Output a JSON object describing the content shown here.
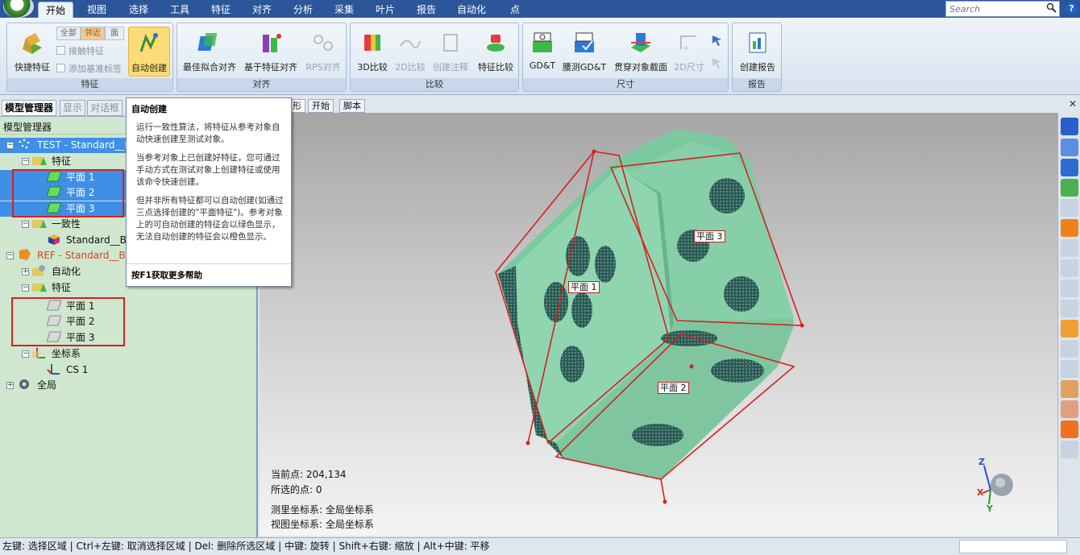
{
  "menubar": {
    "tabs": [
      "开始",
      "视图",
      "选择",
      "工具",
      "特征",
      "对齐",
      "分析",
      "采集",
      "叶片",
      "报告",
      "自动化",
      "点"
    ],
    "active_tab": "开始",
    "search_placeholder": "Search"
  },
  "ribbon": {
    "groups": {
      "feature": "特征",
      "align": "对齐",
      "compare": "比较",
      "dimension": "尺寸",
      "report": "报告"
    },
    "feature": {
      "quick_feature": "快捷特征",
      "seg_all": "全部",
      "seg_near": "邻近",
      "seg_face": "面",
      "touch_feature": "接触特征",
      "add_datum_label": "添加基准标签",
      "auto_create": "自动创建"
    },
    "align": {
      "best_fit": "最佳拟合对齐",
      "feature_based": "基于特征对齐",
      "rps": "RPS对齐"
    },
    "compare": {
      "compare3d": "3D比较",
      "compare2d": "2D比较",
      "create_annotation": "创建注释",
      "feature_compare": "特征比较"
    },
    "dimension": {
      "gdt": "GD&T",
      "measure_gdt": "腰测GD&T",
      "through_section": "贯穿对象截面",
      "dim2d": "2D尺寸"
    },
    "report": {
      "create_report": "创建报告"
    }
  },
  "left_panel": {
    "tabs": [
      "模型管理器",
      "显示",
      "对话框"
    ],
    "title": "模型管理器",
    "tree": {
      "test_root": "TEST - Standard__Bloc",
      "features": "特征",
      "plane1": "平面 1",
      "plane2": "平面 2",
      "plane3": "平面 3",
      "consistency": "一致性",
      "standard_bloc": "Standard__Bloc",
      "ref_root": "REF - Standard__Bloc",
      "automation": "自动化",
      "features2": "特征",
      "coord_sys": "坐标系",
      "cs1": "CS 1",
      "global": "全局"
    }
  },
  "tooltip": {
    "title": "自动创建",
    "p1": "运行一致性算法，将特征从参考对象自动快速创建至测试对象。",
    "p2": "当参考对象上已创建好特征，您可通过手动方式在测试对象上创建特征或使用该命令快速创建。",
    "p3": "但并非所有特征都可以自动创建(如通过三点选择创建的\"平面特征\")。参考对象上的可自动创建的特征会以绿色显示，无法自动创建的特征会以橙色显示。",
    "footer": "按F1获取更多帮助"
  },
  "view_tabs": [
    "形",
    "开始",
    "脚本"
  ],
  "viewport": {
    "tag_plane1": "平面 1",
    "tag_plane2": "平面 2",
    "tag_plane3": "平面 3",
    "current_point": "当前点: 204,134",
    "selected_points": "所选的点: 0",
    "measure_cs": "测里坐标系: 全局坐标系",
    "view_cs": "视图坐标系: 全局坐标系",
    "axis_z": "Z",
    "axis_x": "X",
    "axis_y": "Y"
  },
  "statusbar": {
    "text": "左键: 选择区域 | Ctrl+左键: 取消选择区域 | Del: 删除所选区域 | 中键: 旋转 | Shift+右键: 缩放 | Alt+中键: 平移"
  },
  "colors": {
    "menubar": "#2b579a",
    "panel_green": "#cfe7cf",
    "model_green": "#7cc9a0",
    "selection_blue": "#3f8fe6",
    "highlight_red": "#d62020"
  }
}
